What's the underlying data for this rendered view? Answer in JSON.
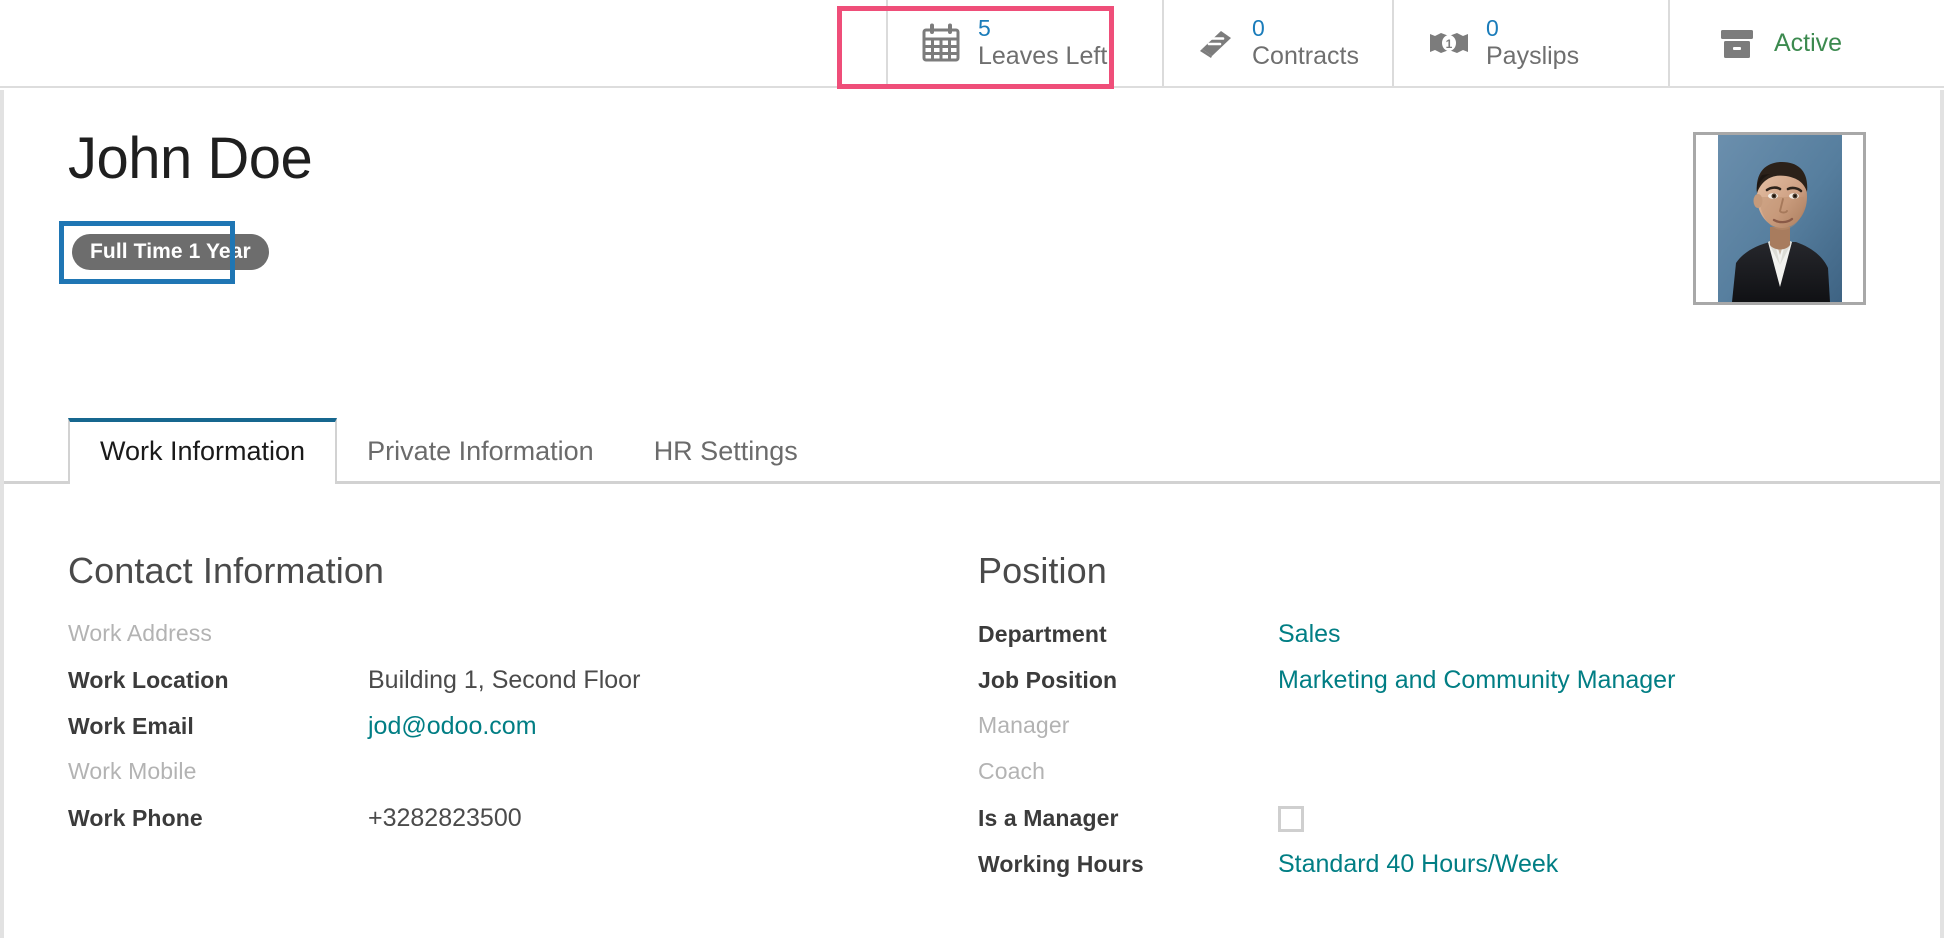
{
  "stat_buttons": [
    {
      "id": "leaves",
      "icon": "calendar-icon",
      "value": "5",
      "label": "Leaves Left",
      "highlighted": true
    },
    {
      "id": "contracts",
      "icon": "book-icon",
      "value": "0",
      "label": "Contracts",
      "highlighted": false
    },
    {
      "id": "payslips",
      "icon": "money-icon",
      "value": "0",
      "label": "Payslips",
      "highlighted": false
    },
    {
      "id": "archive",
      "icon": "box-icon",
      "value": "",
      "label": "Active",
      "highlighted": false
    }
  ],
  "record": {
    "title": "John Doe",
    "badge": "Full Time 1 Year",
    "avatar_alt": "employee-photo"
  },
  "tabs": [
    {
      "label": "Work Information",
      "active": true
    },
    {
      "label": "Private Information",
      "active": false
    },
    {
      "label": "HR Settings",
      "active": false
    }
  ],
  "contact_group": {
    "title": "Contact Information",
    "fields": [
      {
        "label": "Work Address",
        "value": "",
        "type": "text",
        "empty_label": true
      },
      {
        "label": "Work Location",
        "value": "Building 1, Second Floor",
        "type": "text",
        "empty_label": false
      },
      {
        "label": "Work Email",
        "value": "jod@odoo.com",
        "type": "link",
        "empty_label": false
      },
      {
        "label": "Work Mobile",
        "value": "",
        "type": "text",
        "empty_label": true
      },
      {
        "label": "Work Phone",
        "value": "+3282823500",
        "type": "text",
        "empty_label": false
      }
    ]
  },
  "position_group": {
    "title": "Position",
    "fields": [
      {
        "label": "Department",
        "value": "Sales",
        "type": "link",
        "empty_label": false
      },
      {
        "label": "Job Position",
        "value": "Marketing and Community Manager",
        "type": "link",
        "empty_label": false
      },
      {
        "label": "Manager",
        "value": "",
        "type": "text",
        "empty_label": true
      },
      {
        "label": "Coach",
        "value": "",
        "type": "text",
        "empty_label": true
      },
      {
        "label": "Is a Manager",
        "value": "",
        "type": "checkbox",
        "checked": false,
        "empty_label": false
      },
      {
        "label": "Working Hours",
        "value": "Standard 40 Hours/Week",
        "type": "link",
        "empty_label": false
      }
    ]
  },
  "annotations": {
    "pink_box_target": "Leaves Left",
    "pink_color": "#ef4e79",
    "blue_box_target": "Full Time 1 Year",
    "blue_color": "#1f76b4"
  },
  "colors": {
    "stat_value": "#1a7cba",
    "link": "#017e84",
    "active_state": "#3c8a4f",
    "badge_bg": "#6d6d6d",
    "tab_active_border": "#16678f"
  }
}
